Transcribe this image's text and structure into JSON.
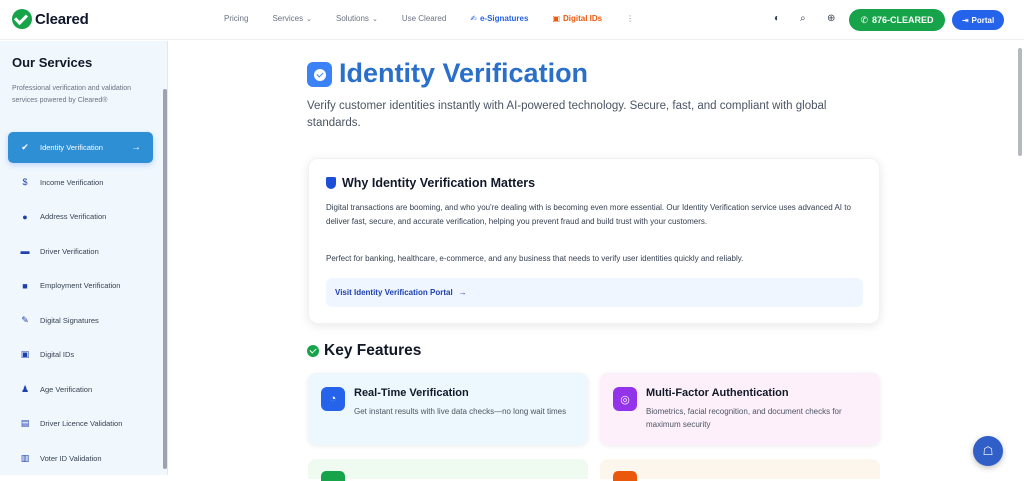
{
  "brand": {
    "name": "Cleared"
  },
  "nav": {
    "items": [
      {
        "label": "Pricing",
        "chevron": false
      },
      {
        "label": "Services",
        "chevron": true
      },
      {
        "label": "Solutions",
        "chevron": true
      },
      {
        "label": "Use Cleared",
        "chevron": false
      }
    ],
    "esignatures": "e-Signatures",
    "digital_ids": "Digital IDs",
    "more": "⋮"
  },
  "header": {
    "theme_icon": "contrast-icon",
    "search_icon": "search-icon",
    "language_icon": "globe-icon",
    "phone_label": "876-CLEARED",
    "portal_label": "Portal"
  },
  "sidebar": {
    "title": "Our Services",
    "description": "Professional verification and validation services powered by Cleared®",
    "items": [
      {
        "label": "Identity Verification",
        "icon": "badge-check-icon",
        "glyph": "✔",
        "active": true
      },
      {
        "label": "Income Verification",
        "icon": "dollar-icon",
        "glyph": "$",
        "active": false
      },
      {
        "label": "Address Verification",
        "icon": "map-pin-icon",
        "glyph": "●",
        "active": false
      },
      {
        "label": "Driver Verification",
        "icon": "car-icon",
        "glyph": "▬",
        "active": false
      },
      {
        "label": "Employment Verification",
        "icon": "briefcase-icon",
        "glyph": "■",
        "active": false
      },
      {
        "label": "Digital Signatures",
        "icon": "pen-icon",
        "glyph": "✎",
        "active": false
      },
      {
        "label": "Digital IDs",
        "icon": "id-card-icon",
        "glyph": "▣",
        "active": false
      },
      {
        "label": "Age Verification",
        "icon": "person-icon",
        "glyph": "♟",
        "active": false
      },
      {
        "label": "Driver Licence Validation",
        "icon": "license-icon",
        "glyph": "▤",
        "active": false
      },
      {
        "label": "Voter ID Validation",
        "icon": "voter-icon",
        "glyph": "▥",
        "active": false
      }
    ]
  },
  "hero": {
    "title": "Identity Verification",
    "subtitle": "Verify customer identities instantly with AI-powered technology. Secure, fast, and compliant with global standards."
  },
  "why": {
    "title": "Why Identity Verification Matters",
    "p1": "Digital transactions are booming, and who you're dealing with is becoming even more essential. Our Identity Verification service uses advanced AI to deliver fast, secure, and accurate verification, helping you prevent fraud and build trust with your customers.",
    "p2": "Perfect for banking, healthcare, e-commerce, and any business that needs to verify user identities quickly and reliably.",
    "link": "Visit Identity Verification Portal"
  },
  "features": {
    "title": "Key Features",
    "items": [
      {
        "title": "Real-Time Verification",
        "desc": "Get instant results with live data checks—no long wait times",
        "icon": "gauge-icon"
      },
      {
        "title": "Multi-Factor Authentication",
        "desc": "Biometrics, facial recognition, and document checks for maximum security",
        "icon": "fingerprint-icon"
      }
    ]
  },
  "floating": {
    "icon": "chat-bot-icon"
  }
}
